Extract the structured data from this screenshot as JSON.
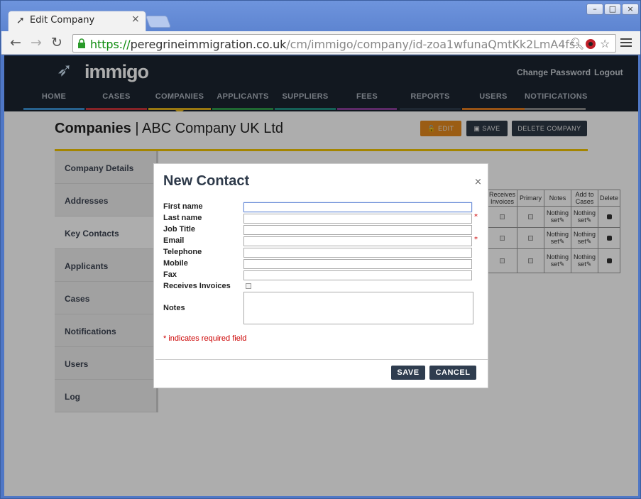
{
  "browser": {
    "tab_title": "Edit Company",
    "url_scheme": "https://",
    "url_host": "peregrineimmigration.co.uk",
    "url_path": "/cm/immigo/company/id-zoa1wfunaQmtKk2LmA4fs:"
  },
  "site": {
    "logo": "immigo",
    "header_links": [
      "Change Password",
      "Logout"
    ],
    "nav": [
      {
        "label": "HOME",
        "color": "#3a8fd0"
      },
      {
        "label": "CASES",
        "color": "#c8343a"
      },
      {
        "label": "COMPANIES",
        "color": "#e2b21a"
      },
      {
        "label": "APPLICANTS",
        "color": "#2e9a4a"
      },
      {
        "label": "SUPPLIERS",
        "color": "#1f8e80"
      },
      {
        "label": "FEES",
        "color": "#8a3f9a"
      },
      {
        "label": "REPORTS",
        "color": "#2d3a4a"
      },
      {
        "label": "USERS",
        "color": "#e07b20"
      },
      {
        "label": "NOTIFICATIONS",
        "color": "#8a8a8a"
      }
    ]
  },
  "page": {
    "title_bold": "Companies",
    "title_rest": " | ABC Company UK Ltd",
    "buttons": {
      "edit": "EDIT",
      "save": "SAVE",
      "delete": "DELETE COMPANY"
    },
    "sidebar": [
      "Company Details",
      "Addresses",
      "Key Contacts",
      "Applicants",
      "Cases",
      "Notifications",
      "Users",
      "Log"
    ],
    "table_headers": [
      "Receives Invoices",
      "Primary",
      "Notes",
      "Add to Cases",
      "Delete"
    ],
    "table_cell_text": "Nothing set"
  },
  "modal": {
    "title": "New Contact",
    "close": "×",
    "fields": [
      {
        "label": "First name",
        "required": false
      },
      {
        "label": "Last name",
        "required": true
      },
      {
        "label": "Job Title",
        "required": false
      },
      {
        "label": "Email",
        "required": true
      },
      {
        "label": "Telephone",
        "required": false
      },
      {
        "label": "Mobile",
        "required": false
      },
      {
        "label": "Fax",
        "required": false
      }
    ],
    "checkbox_label": "Receives Invoices",
    "notes_label": "Notes",
    "required_mark": "*",
    "required_note": "* indicates required field",
    "save_label": "SAVE",
    "cancel_label": "CANCEL"
  }
}
